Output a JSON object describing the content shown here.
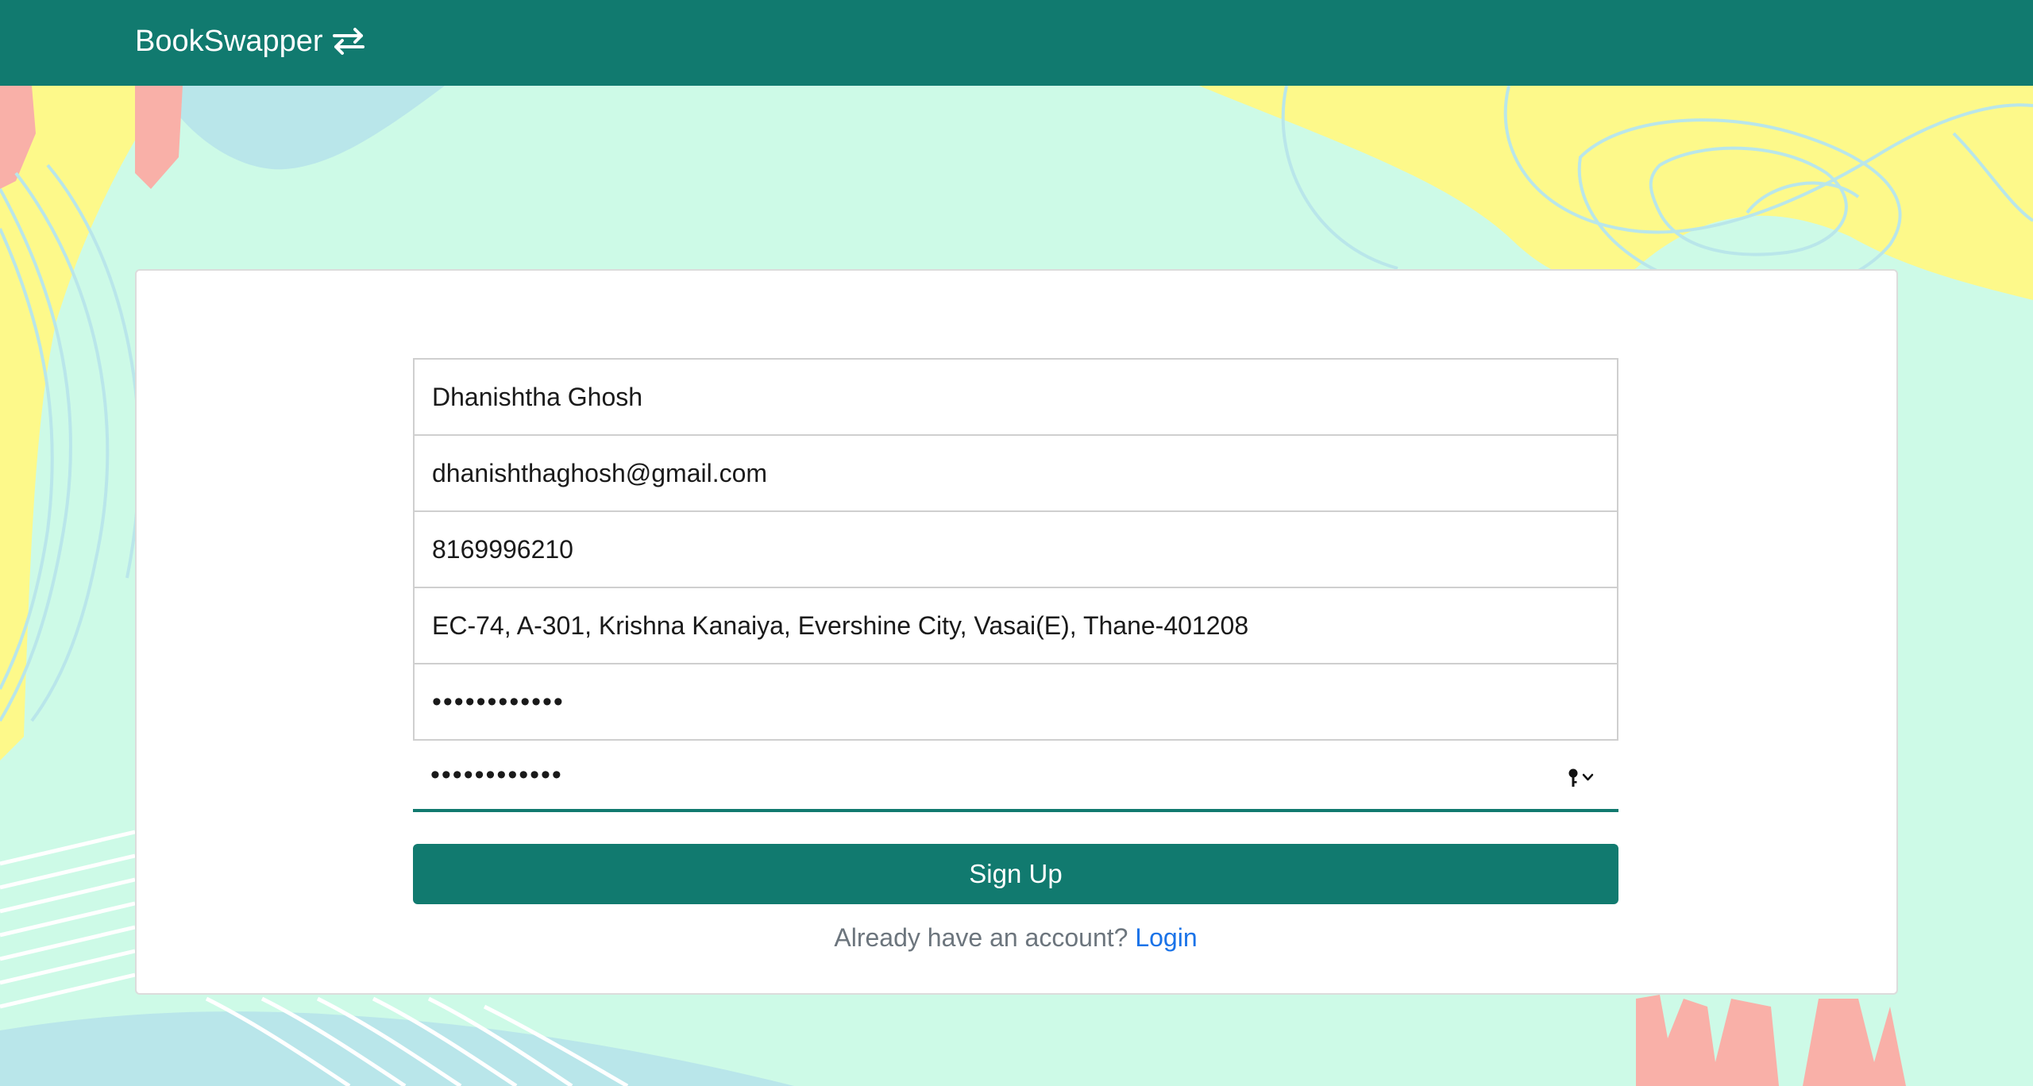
{
  "navbar": {
    "brand_label": "BookSwapper",
    "brand_icon": "swap-arrows-icon"
  },
  "form": {
    "name_value": "Dhanishtha Ghosh",
    "email_value": "dhanishthaghosh@gmail.com",
    "phone_value": "8169996210",
    "address_value": "EC-74, A-301, Krishna Kanaiya, Evershine City, Vasai(E), Thane-401208",
    "password_value": "••••••••••••",
    "confirm_password_value": "••••••••••••",
    "password_manager_icon": "key-icon",
    "submit_label": "Sign Up"
  },
  "footer": {
    "prompt_text": "Already have an account?",
    "login_label": "Login"
  },
  "colors": {
    "primary": "#117a6f",
    "background": "#cdfae7",
    "accent_yellow": "#fdf98a",
    "accent_blue": "#b9e6ea",
    "accent_pink": "#f9b0a8",
    "link": "#1a73e8"
  }
}
